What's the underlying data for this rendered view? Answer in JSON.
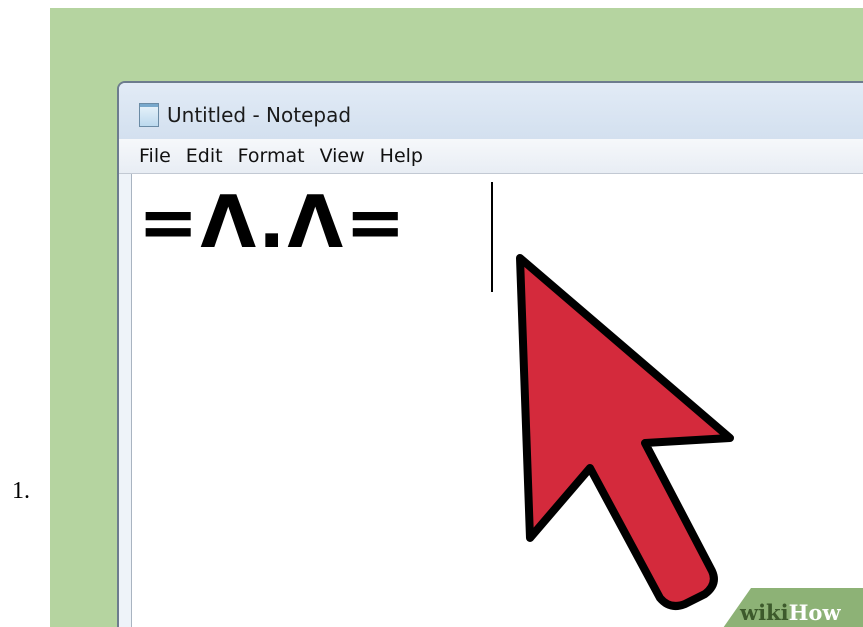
{
  "list_marker": "1.",
  "window": {
    "title": "Untitled - Notepad",
    "menu": [
      "File",
      "Edit",
      "Format",
      "View",
      "Help"
    ]
  },
  "editor": {
    "content": "=Λ.Λ="
  },
  "watermark": {
    "part1": "wiki",
    "part2": "How"
  },
  "colors": {
    "background": "#b5d4a0",
    "cursor_fill": "#d42a3c",
    "cursor_outline": "#000000"
  },
  "icons": [
    "notepad-icon",
    "mouse-pointer-icon"
  ]
}
